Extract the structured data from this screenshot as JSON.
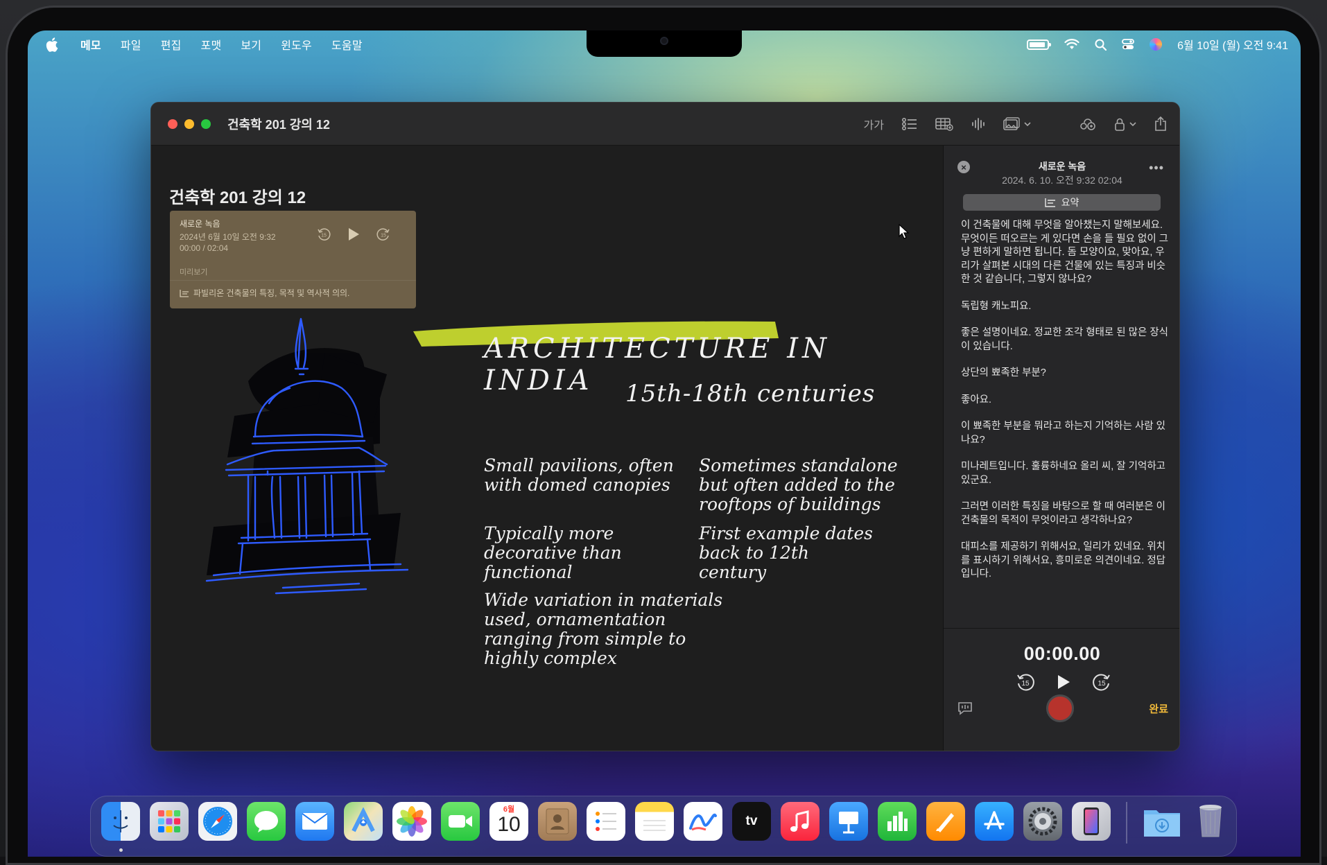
{
  "menubar": {
    "items": [
      "메모",
      "파일",
      "편집",
      "포맷",
      "보기",
      "윈도우",
      "도움말"
    ],
    "datetime": "6월 10일 (월) 오전 9:41"
  },
  "window": {
    "title": "건축학 201 강의 12",
    "toolbar": {
      "format_label": "가가"
    }
  },
  "note": {
    "title": "건축학 201 강의 12",
    "audio_card": {
      "title": "새로운 녹음",
      "date": "2024년 6월 10일 오전 9:32",
      "time": "00:00 / 02:04",
      "preview_label": "미리보기",
      "summary": "파빌리온 건축물의 특징, 목적 및 역사적 의의."
    },
    "handwriting": {
      "heading": "ARCHITECTURE IN INDIA",
      "subheading": "15th-18th centuries",
      "bullets": [
        "Small pavilions, often with domed canopies",
        "Typically more decorative than functional",
        "Wide variation in materials used, ornamentation ranging from simple to highly complex",
        "Sometimes standalone but often added to the rooftops of buildings",
        "First example dates back to 12th century"
      ]
    }
  },
  "panel": {
    "title": "새로운 녹음",
    "meta": "2024. 6. 10. 오전 9:32  02:04",
    "summary_button": "요약",
    "transcript": [
      "이 건축물에 대해 무엇을 알아챘는지 말해보세요. 무엇이든 떠오르는 게 있다면 손을 들 필요 없이 그냥 편하게 말하면 됩니다. 돔 모양이요, 맞아요, 우리가 살펴본 시대의 다른 건물에 있는 특징과 비슷한 것 같습니다, 그렇지 않나요?",
      "독립형 캐노피요.",
      "좋은 설명이네요. 정교한 조각 형태로 된 많은 장식이 있습니다.",
      "상단의 뾰족한 부분?",
      "좋아요.",
      "이 뾰족한 부분을 뭐라고 하는지 기억하는 사람 있나요?",
      "미나레트입니다. 훌륭하네요 올리 씨, 잘 기억하고 있군요.",
      "그러면 이러한 특징을 바탕으로 할 때 여러분은 이 건축물의 목적이 무엇이라고 생각하나요?",
      "대피소를 제공하기 위해서요, 일리가 있네요. 위치를 표시하기 위해서요, 흥미로운 의견이네요. 정답입니다."
    ],
    "timer": "00:00.00",
    "done_label": "완료"
  },
  "dock": {
    "calendar_month": "6월",
    "calendar_day": "10"
  },
  "colors": {
    "highlight": "#c7d92f",
    "sketch_blue": "#2e5bff",
    "record": "#b7332c",
    "done": "#f0b93a"
  }
}
